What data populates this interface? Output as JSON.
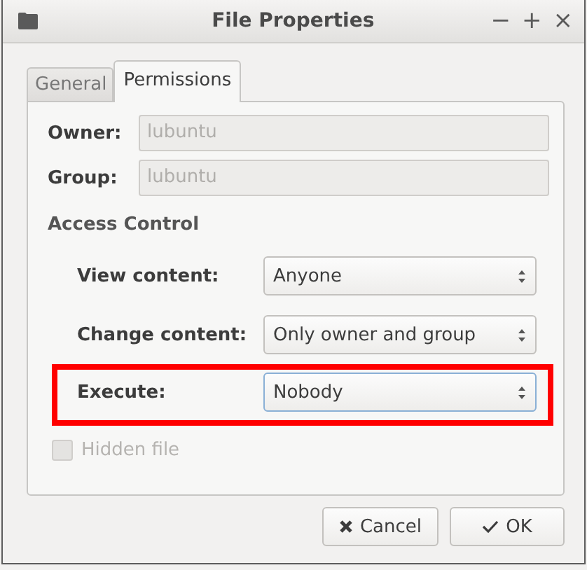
{
  "window": {
    "title": "File Properties",
    "controls": [
      "−",
      "+",
      "×"
    ]
  },
  "tabs": [
    {
      "label": "General",
      "selected": false
    },
    {
      "label": "Permissions",
      "selected": true
    }
  ],
  "ownership": [
    {
      "label": "Owner:",
      "value": "lubuntu",
      "disabled": true
    },
    {
      "label": "Group:",
      "value": "lubuntu",
      "disabled": true
    }
  ],
  "access_control": {
    "heading": "Access Control",
    "rows": [
      {
        "label": "View content:",
        "value": "Anyone",
        "highlighted": false
      },
      {
        "label": "Change content:",
        "value": "Only owner and group",
        "highlighted": false
      },
      {
        "label": "Execute:",
        "value": "Nobody",
        "highlighted": true
      }
    ]
  },
  "hidden_file": {
    "label": "Hidden file",
    "checked": false,
    "disabled": true
  },
  "buttons": [
    {
      "label": "Cancel",
      "kind": "cancel"
    },
    {
      "label": "OK",
      "kind": "ok"
    }
  ]
}
